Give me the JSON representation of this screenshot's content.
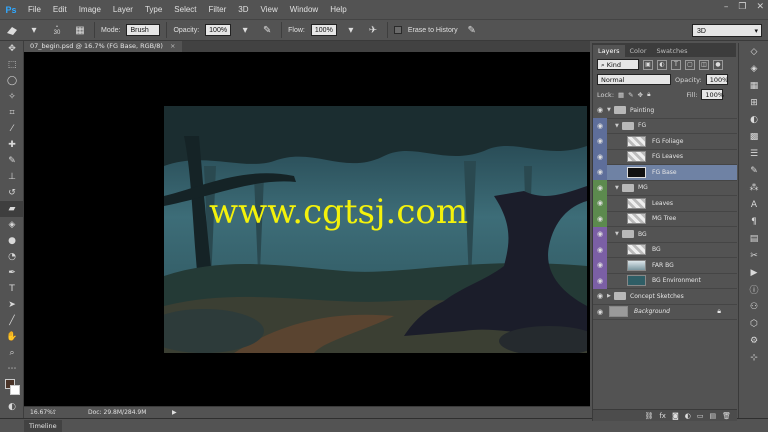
{
  "app": {
    "logo": "Ps",
    "menu": [
      "File",
      "Edit",
      "Image",
      "Layer",
      "Type",
      "Select",
      "Filter",
      "3D",
      "View",
      "Window",
      "Help"
    ],
    "window_controls": [
      "–",
      "❐",
      "✕"
    ]
  },
  "options_bar": {
    "brush_size": "30",
    "mode_label": "Mode:",
    "mode_value": "Brush",
    "opacity_label": "Opacity:",
    "opacity_value": "100%",
    "flow_label": "Flow:",
    "flow_value": "100%",
    "erase_history_label": "Erase to History",
    "workspace_value": "3D"
  },
  "document": {
    "tab_title": "07_begin.psd @ 16.7% (FG Base, RGB/8)",
    "tab_close": "×",
    "watermark": "www.cgtsj.com"
  },
  "status_bar": {
    "zoom": "16.67%",
    "doc_size": "Doc: 29.8M/284.9M"
  },
  "timeline": {
    "label": "Timeline"
  },
  "layers_panel": {
    "tabs": [
      "Layers",
      "Color",
      "Swatches"
    ],
    "filter_kind": "Kind",
    "blend_mode": "Normal",
    "opacity_label": "Opacity:",
    "opacity_value": "100%",
    "lock_label": "Lock:",
    "fill_label": "Fill:",
    "fill_value": "100%",
    "layers": [
      {
        "name": "Painting",
        "type": "group",
        "indent": 0,
        "color": ""
      },
      {
        "name": "FG",
        "type": "group",
        "indent": 1,
        "color": "#5e6e9a"
      },
      {
        "name": "FG Foliage",
        "type": "layer",
        "indent": 2,
        "color": "#5e6e9a"
      },
      {
        "name": "FG Leaves",
        "type": "layer",
        "indent": 2,
        "color": "#5e6e9a"
      },
      {
        "name": "FG Base",
        "type": "layer",
        "indent": 2,
        "color": "#5e6e9a",
        "selected": true
      },
      {
        "name": "MG",
        "type": "group",
        "indent": 1,
        "color": "#5c8a4e"
      },
      {
        "name": "Leaves",
        "type": "layer",
        "indent": 2,
        "color": "#5c8a4e"
      },
      {
        "name": "MG Tree",
        "type": "layer",
        "indent": 2,
        "color": "#5c8a4e"
      },
      {
        "name": "BG",
        "type": "group",
        "indent": 1,
        "color": "#7b5fa5"
      },
      {
        "name": "BG",
        "type": "layer",
        "indent": 2,
        "color": "#7b5fa5"
      },
      {
        "name": "FAR BG",
        "type": "layer",
        "indent": 2,
        "color": "#7b5fa5"
      },
      {
        "name": "BG Environment",
        "type": "layer",
        "indent": 2,
        "color": "#7b5fa5"
      },
      {
        "name": "Concept Sketches",
        "type": "group",
        "indent": 0,
        "color": ""
      },
      {
        "name": "Background",
        "type": "background",
        "indent": 0,
        "color": ""
      }
    ]
  },
  "colors": {
    "ui_bg": "#535353",
    "selected_layer": "#6f82a4",
    "watermark": "#f4f20b"
  }
}
